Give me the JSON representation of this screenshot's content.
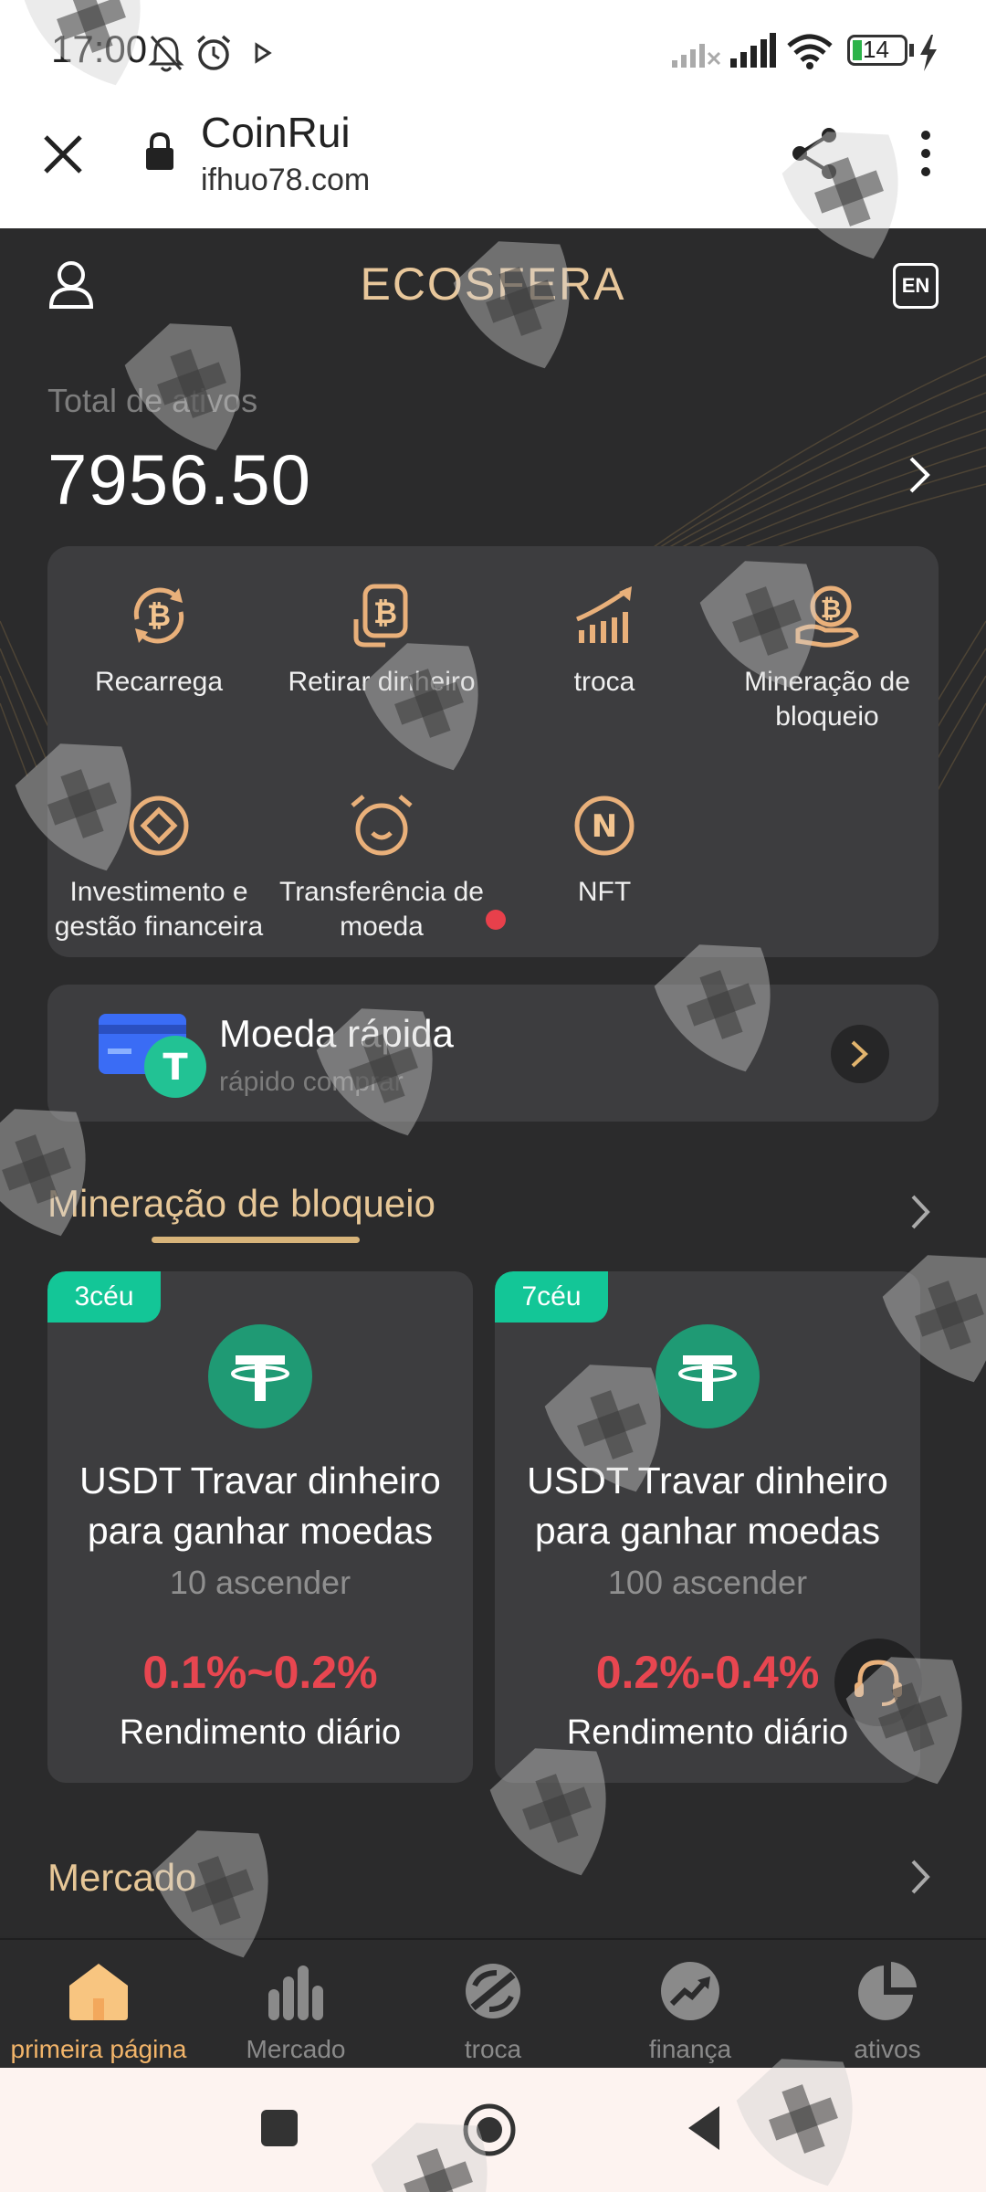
{
  "status_bar": {
    "time": "17:00",
    "battery": "14",
    "icons": [
      "mute-icon",
      "alarm-icon",
      "play-icon",
      "no-signal-icon",
      "signal-icon",
      "wifi-icon",
      "battery-icon",
      "charging-icon"
    ]
  },
  "browser": {
    "site_title": "CoinRui",
    "url": "ifhuo78.com",
    "icons": [
      "close-icon",
      "lock-icon",
      "share-icon",
      "more-icon"
    ]
  },
  "app": {
    "title": "ECOSFERA",
    "lang": "EN",
    "total_label": "Total de ativos",
    "total_value": "7956.50"
  },
  "actions": [
    {
      "label": "Recarrega",
      "icon": "bitcoin-recharge-icon"
    },
    {
      "label": "Retirar dinheiro",
      "icon": "bitcoin-withdraw-icon"
    },
    {
      "label": "troca",
      "icon": "trend-chart-icon"
    },
    {
      "label": "Mineração de bloqueio",
      "icon": "bitcoin-mining-icon"
    },
    {
      "label": "Investimento e gestão financeira",
      "icon": "investment-icon"
    },
    {
      "label": "Transferência de moeda",
      "icon": "transfer-clock-icon"
    },
    {
      "label": "NFT",
      "icon": "nft-icon"
    }
  ],
  "quick_coin": {
    "title": "Moeda rápida",
    "subtitle": "rápido comprar"
  },
  "mining": {
    "section_title": "Mineração de bloqueio",
    "cards": [
      {
        "badge": "3céu",
        "title": "USDT Travar dinheiro para ganhar moedas",
        "min": "10 ascender",
        "rate": "0.1%~0.2%",
        "rate_label": "Rendimento diário"
      },
      {
        "badge": "7céu",
        "title": "USDT Travar dinheiro para ganhar moedas",
        "min": "100 ascender",
        "rate": "0.2%-0.4%",
        "rate_label": "Rendimento diário"
      }
    ]
  },
  "market": {
    "section_title": "Mercado"
  },
  "tabbar": [
    {
      "label": "primeira página",
      "icon": "home-icon",
      "active": true
    },
    {
      "label": "Mercado",
      "icon": "bar-chart-icon",
      "active": false
    },
    {
      "label": "troca",
      "icon": "exchange-icon",
      "active": false
    },
    {
      "label": "finança",
      "icon": "finance-icon",
      "active": false
    },
    {
      "label": "ativos",
      "icon": "pie-chart-icon",
      "active": false
    }
  ],
  "colors": {
    "accent_gold": "#e8c79b",
    "badge_green": "#13c697",
    "rate_red": "#e84650",
    "background": "#2b2b2c",
    "panel": "#3d3d3f"
  }
}
